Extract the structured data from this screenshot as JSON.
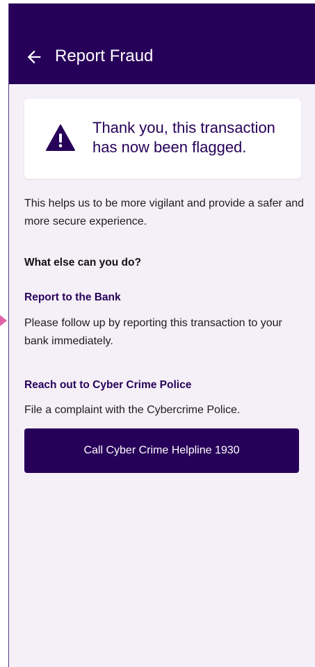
{
  "app_bar": {
    "title": "Report Fraud",
    "back_icon": "arrow-left-icon",
    "background": "#270059"
  },
  "notice": {
    "icon": "warning-triangle-icon",
    "text": "Thank you, this transaction has now been flagged."
  },
  "intro_text": "This helps us to be more vigilant and provide a safer and more secure experience.",
  "what_else_heading": "What  else can you do?",
  "bank_section": {
    "heading": "Report to the Bank",
    "text": "Please follow up by reporting this transaction to your bank immediately."
  },
  "police_section": {
    "heading": "Reach out to Cyber Crime Police",
    "text": "File a complaint with the Cybercrime Police."
  },
  "helpline_button_label": "Call Cyber Crime Helpline 1930",
  "colors": {
    "primary": "#270059",
    "surface": "#f5f0f7",
    "marker": "#e062a8"
  }
}
